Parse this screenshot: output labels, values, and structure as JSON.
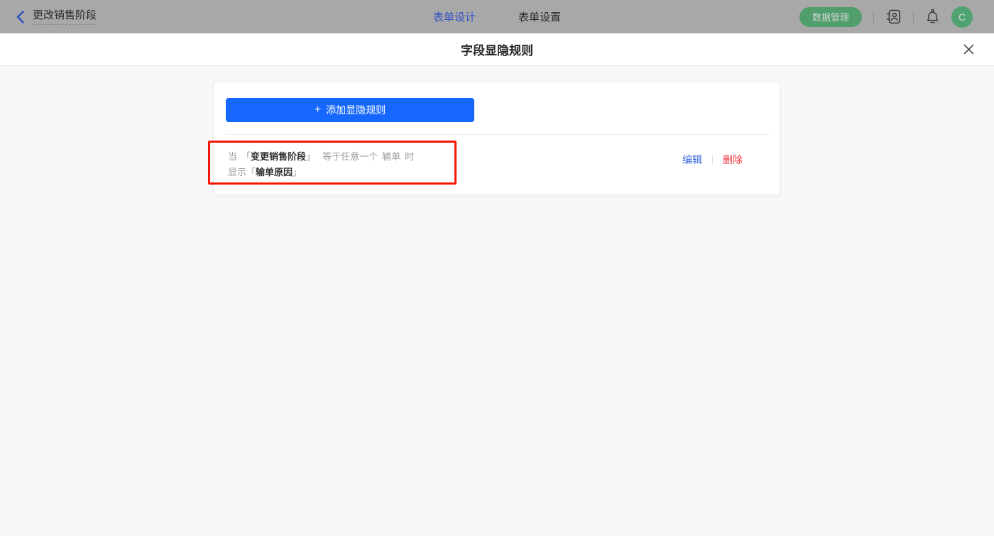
{
  "topbar": {
    "back_label": "更改销售阶段",
    "tabs": {
      "design": "表单设计",
      "settings": "表单设置"
    },
    "data_manage_label": "数据管理",
    "avatar_letter": "C"
  },
  "modal": {
    "title": "字段显隐规则",
    "add_rule": {
      "plus": "+",
      "label": "添加显隐规则"
    },
    "rule": {
      "when": "当",
      "bracket_open": "「",
      "field": "变更销售阶段",
      "bracket_close": "」",
      "operator": "等于任意一个",
      "value": "输单",
      "when_suffix": "时",
      "action": "显示",
      "target_bracket_open": "「",
      "target_field": "输单原因",
      "target_bracket_close": "」"
    },
    "actions": {
      "edit": "编辑",
      "delete": "删除"
    }
  },
  "colors": {
    "primary_blue": "#1567fd",
    "edit_link_blue": "#3b66dd",
    "delete_red": "#f0303d",
    "annotation_red": "#f41804",
    "topbar_dimmed_bg": "#a8a8a8",
    "brand_green_dimmed": "#4f9e6c",
    "active_tab_blue_dimmed": "#3353c8",
    "modal_body_bg": "#f8f8fa"
  }
}
